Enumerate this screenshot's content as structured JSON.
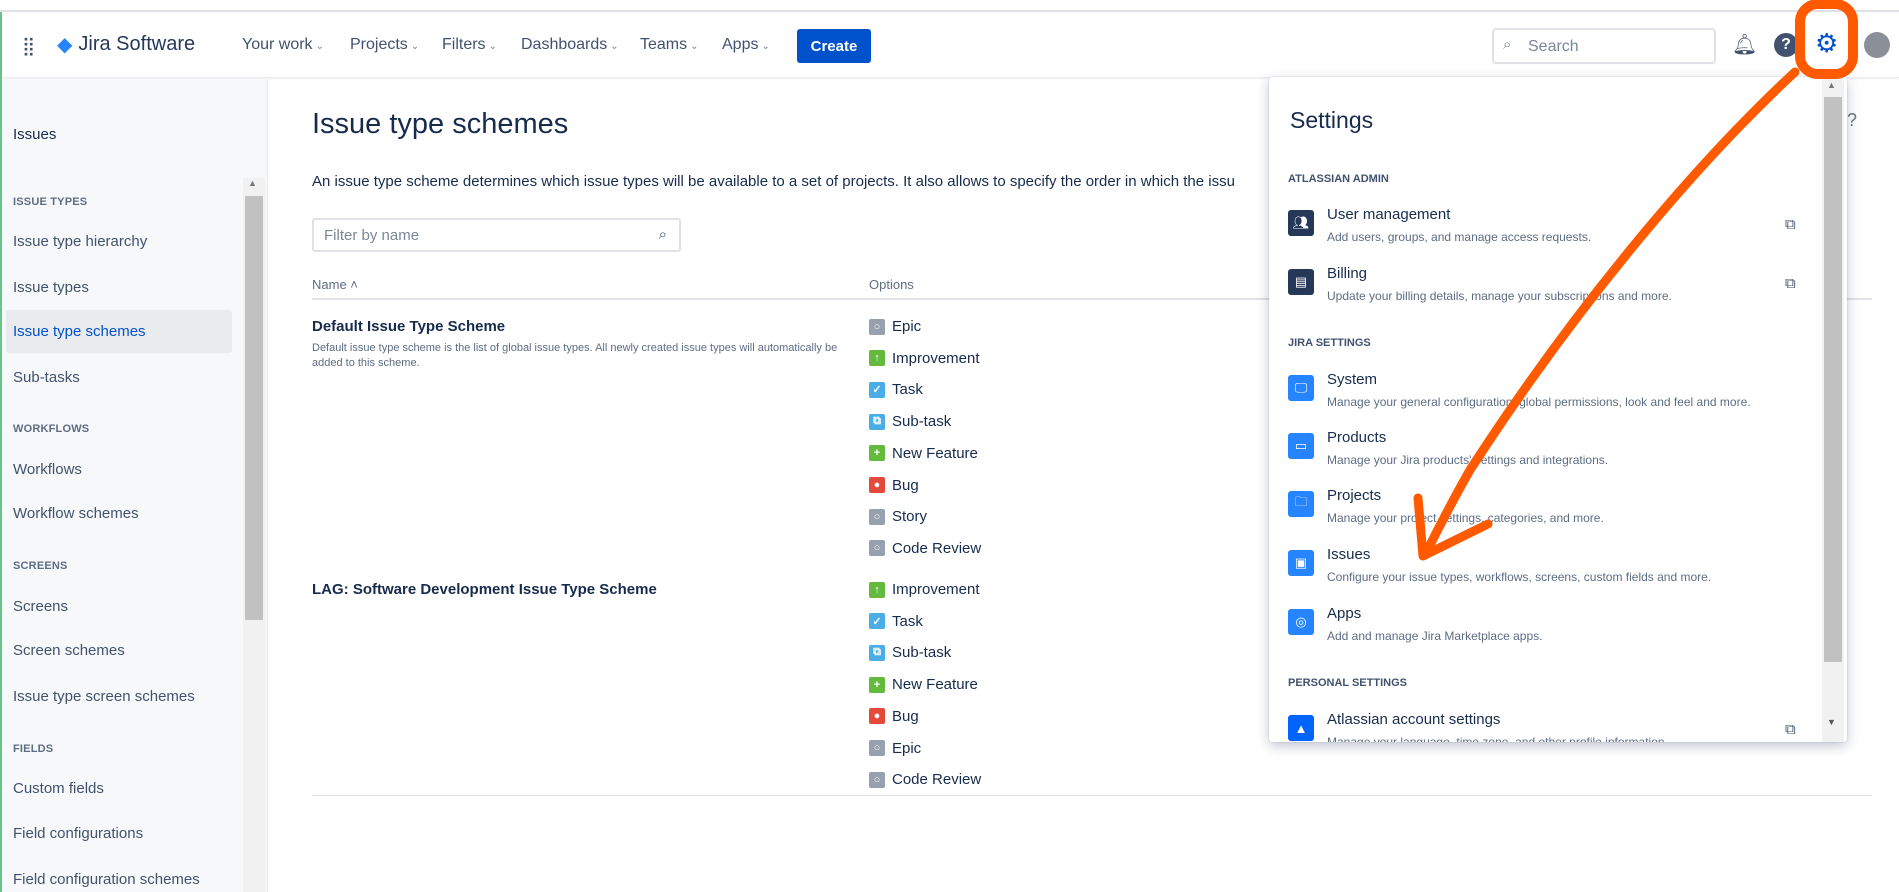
{
  "header": {
    "app_name": "Jira Software",
    "nav": [
      "Your work",
      "Projects",
      "Filters",
      "Dashboards",
      "Teams",
      "Apps"
    ],
    "create": "Create",
    "search_placeholder": "Search"
  },
  "sidebar": {
    "title": "Issues",
    "groups": [
      {
        "heading": "ISSUE TYPES",
        "items": [
          "Issue type hierarchy",
          "Issue types",
          "Issue type schemes",
          "Sub-tasks"
        ]
      },
      {
        "heading": "WORKFLOWS",
        "items": [
          "Workflows",
          "Workflow schemes"
        ]
      },
      {
        "heading": "SCREENS",
        "items": [
          "Screens",
          "Screen schemes",
          "Issue type screen schemes"
        ]
      },
      {
        "heading": "FIELDS",
        "items": [
          "Custom fields",
          "Field configurations",
          "Field configuration schemes"
        ]
      }
    ],
    "selected": "Issue type schemes"
  },
  "main": {
    "title": "Issue type schemes",
    "description": "An issue type scheme determines which issue types will be available to a set of projects. It also allows to specify the order in which the issu",
    "filter_placeholder": "Filter by name",
    "columns": [
      "Name ˄",
      "Options"
    ],
    "schemes": [
      {
        "name": "Default Issue Type Scheme",
        "description": "Default issue type scheme is the list of global issue types. All newly created issue types will automatically be added to this scheme.",
        "options": [
          "Epic",
          "Improvement",
          "Task",
          "Sub-task",
          "New Feature",
          "Bug",
          "Story",
          "Code Review"
        ]
      },
      {
        "name": "LAG: Software Development Issue Type Scheme",
        "description": "",
        "options": [
          "Improvement",
          "Task",
          "Sub-task",
          "New Feature",
          "Bug",
          "Epic",
          "Code Review"
        ]
      }
    ]
  },
  "issue_type_colors": {
    "Epic": "#97a0af",
    "Improvement": "#63ba3c",
    "Task": "#4bade8",
    "Sub-task": "#4bade8",
    "New Feature": "#63ba3c",
    "Bug": "#e5493a",
    "Story": "#97a0af",
    "Code Review": "#97a0af"
  },
  "settings_menu": {
    "title": "Settings",
    "sections": [
      {
        "heading": "ATLASSIAN ADMIN",
        "items": [
          {
            "title": "User management",
            "subtitle": "Add users, groups, and manage access requests.",
            "external": true,
            "icon": "users-icon"
          },
          {
            "title": "Billing",
            "subtitle": "Update your billing details, manage your subscriptions and more.",
            "external": true,
            "icon": "billing-icon"
          }
        ]
      },
      {
        "heading": "JIRA SETTINGS",
        "items": [
          {
            "title": "System",
            "subtitle": "Manage your general configuration, global permissions, look and feel and more.",
            "icon": "monitor-icon"
          },
          {
            "title": "Products",
            "subtitle": "Manage your Jira products' settings and integrations.",
            "icon": "products-icon"
          },
          {
            "title": "Projects",
            "subtitle": "Manage your project settings, categories, and more.",
            "icon": "folder-icon"
          },
          {
            "title": "Issues",
            "subtitle": "Configure your issue types, workflows, screens, custom fields and more.",
            "icon": "issues-icon"
          },
          {
            "title": "Apps",
            "subtitle": "Add and manage Jira Marketplace apps.",
            "icon": "apps-icon"
          }
        ]
      },
      {
        "heading": "PERSONAL SETTINGS",
        "items": [
          {
            "title": "Atlassian account settings",
            "subtitle": "Manage your language, time zone, and other profile information.",
            "external": true,
            "icon": "atlassian-icon"
          }
        ]
      }
    ]
  },
  "annotation_color": "#ff5a00"
}
